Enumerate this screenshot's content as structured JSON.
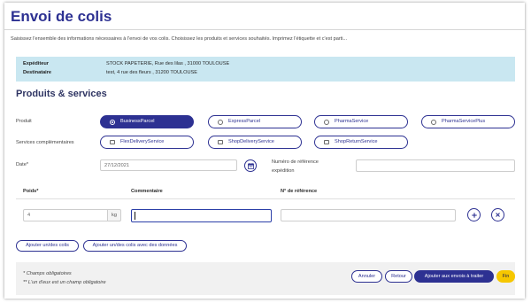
{
  "header": {
    "title": "Envoi de colis",
    "description": "Saisissez l'ensemble des informations nécessaires à l'envoi de vos colis. Choisissez les produits et services souhaités. Imprimez l'étiquette et c'est parti..."
  },
  "addresses": {
    "sender_label": "Expéditeur",
    "sender_value": "STOCK PAPETERIE, Rue des lilas , 31000 TOULOUSE",
    "recipient_label": "Destinataire",
    "recipient_value": "test, 4 rue des fleurs , 31200 TOULOUSE"
  },
  "products_services": {
    "title": "Produits & services",
    "product_label": "Produit",
    "products": [
      {
        "label": "BusinessParcel",
        "selected": true
      },
      {
        "label": "ExpressParcel",
        "selected": false
      },
      {
        "label": "PharmaService",
        "selected": false
      },
      {
        "label": "PharmaServicePlus",
        "selected": false
      }
    ],
    "services_label": "Services complémentaires",
    "services": [
      {
        "label": "FlexDeliveryService",
        "checked": false
      },
      {
        "label": "ShopDeliveryService",
        "checked": false
      },
      {
        "label": "ShopReturnService",
        "checked": false
      }
    ],
    "date_label": "Date*",
    "date_value": "27/12/2021",
    "shipment_reference_label": "Numéro de référence expédition",
    "shipment_reference_value": ""
  },
  "parcels": {
    "columns": {
      "weight": "Poids*",
      "comment": "Commentaire",
      "reference": "N° de référence"
    },
    "rows": [
      {
        "weight": "4",
        "unit": "kg",
        "comment": "",
        "reference": ""
      }
    ],
    "add_button": "Ajouter un/des colis",
    "add_with_data_button": "Ajouter un/des colis avec des données"
  },
  "footer": {
    "note_required": "* Champs obligatoires",
    "note_one_required": "** L'un d'eux est un champ obligatoire",
    "cancel": "Annuler",
    "back": "Retour",
    "submit": "Ajouter aux envois à traiter",
    "finish": "Fin"
  },
  "icons": {
    "date_picker": "calendar-icon",
    "add_row": "plus-icon",
    "remove_row": "close-icon",
    "product_option": "radio-icon",
    "service_option": "checkbox-icon"
  },
  "colors": {
    "primary": "#2d3192",
    "info_box": "#c9e7f1",
    "accent": "#f6c700",
    "footer": "#f1f1f1",
    "focus": "#2b3fa8"
  }
}
